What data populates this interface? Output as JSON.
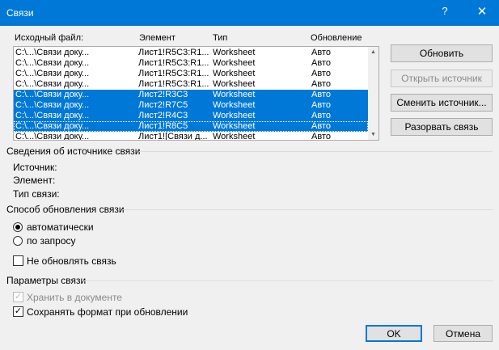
{
  "window": {
    "title": "Связи",
    "help_glyph": "?",
    "close_glyph": "✕"
  },
  "table": {
    "columns": [
      "Исходный файл:",
      "Элемент",
      "Тип",
      "Обновление"
    ],
    "rows": [
      {
        "file": "C:\\...\\Связи доку...",
        "item": "Лист1!R5C3:R1...",
        "type": "Worksheet",
        "update": "Авто",
        "selected": false
      },
      {
        "file": "C:\\...\\Связи доку...",
        "item": "Лист1!R5C3:R1...",
        "type": "Worksheet",
        "update": "Авто",
        "selected": false
      },
      {
        "file": "C:\\...\\Связи доку...",
        "item": "Лист1!R5C3:R1...",
        "type": "Worksheet",
        "update": "Авто",
        "selected": false
      },
      {
        "file": "C:\\...\\Связи доку...",
        "item": "Лист1!R5C3:R1...",
        "type": "Worksheet",
        "update": "Авто",
        "selected": false
      },
      {
        "file": "C:\\...\\Связи доку...",
        "item": "Лист2!R3C3",
        "type": "Worksheet",
        "update": "Авто",
        "selected": true
      },
      {
        "file": "C:\\...\\Связи доку...",
        "item": "Лист2!R7C5",
        "type": "Worksheet",
        "update": "Авто",
        "selected": true
      },
      {
        "file": "C:\\...\\Связи доку...",
        "item": "Лист2!R4C3",
        "type": "Worksheet",
        "update": "Авто",
        "selected": true
      },
      {
        "file": "C:\\...\\Связи доку...",
        "item": "Лист1!R8C5",
        "type": "Worksheet",
        "update": "Авто",
        "selected": true,
        "focused": true
      },
      {
        "file": "C:\\...\\Связи доку...",
        "item": "Лист1![Связи д...",
        "type": "Worksheet",
        "update": "Авто",
        "selected": false
      }
    ],
    "scroll_up_glyph": "▲",
    "scroll_down_glyph": "▼"
  },
  "buttons": {
    "update": "Обновить",
    "open_source": "Открыть источник",
    "change_source": "Сменить источник...",
    "break_link": "Разорвать связь",
    "ok": "OK",
    "cancel": "Отмена"
  },
  "source_info": {
    "title": "Сведения об источнике связи",
    "source_label": "Источник:",
    "item_label": "Элемент:",
    "type_label": "Тип связи:"
  },
  "update_method": {
    "title": "Способ обновления связи",
    "automatic": "автоматически",
    "manual": "по запросу",
    "no_update": "Не обновлять связь"
  },
  "link_params": {
    "title": "Параметры связи",
    "store": "Хранить в документе",
    "keep_format": "Сохранять формат при обновлении",
    "check_glyph": "✓"
  }
}
